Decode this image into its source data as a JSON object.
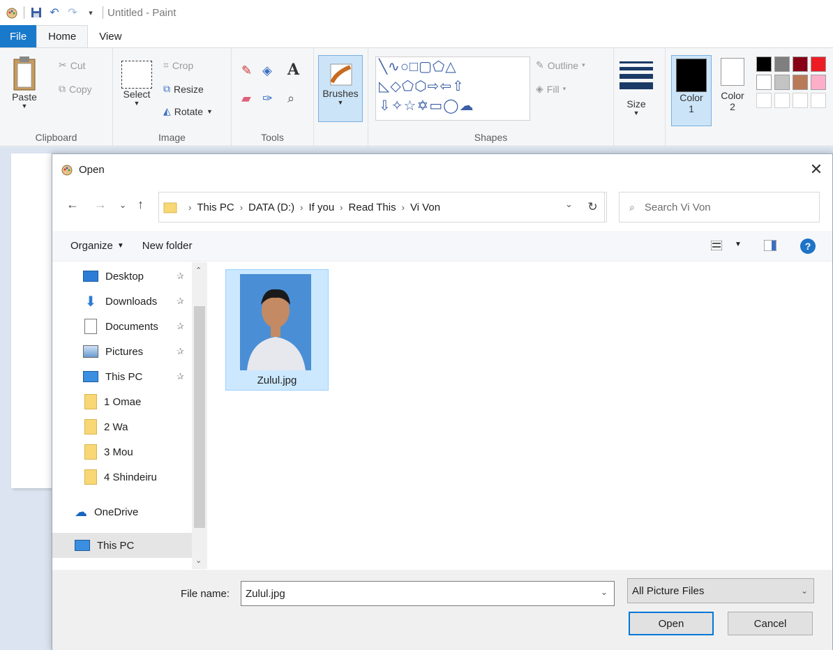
{
  "window": {
    "title": "Untitled - Paint"
  },
  "tabs": [
    {
      "label": "File"
    },
    {
      "label": "Home"
    },
    {
      "label": "View"
    }
  ],
  "ribbon": {
    "clipboard": {
      "label": "Clipboard",
      "paste": "Paste",
      "cut": "Cut",
      "copy": "Copy"
    },
    "image": {
      "label": "Image",
      "select": "Select",
      "crop": "Crop",
      "resize": "Resize",
      "rotate": "Rotate"
    },
    "tools": {
      "label": "Tools"
    },
    "brushes": {
      "label": "Brushes"
    },
    "shapes": {
      "label": "Shapes",
      "outline": "Outline",
      "fill": "Fill"
    },
    "size": {
      "label": "Size"
    },
    "color1": {
      "label": "Color",
      "num": "1"
    },
    "color2": {
      "label": "Color",
      "num": "2"
    },
    "palette": [
      "#000000",
      "#7f7f7f",
      "#880015",
      "#ed1c24",
      "#ffffff",
      "#c3c3c3",
      "#b97a57",
      "#ffaec9"
    ]
  },
  "dialog": {
    "title": "Open",
    "breadcrumb": [
      "This PC",
      "DATA (D:)",
      "If you",
      "Read This",
      "Vi Von"
    ],
    "search_placeholder": "Search Vi Von",
    "organize": "Organize",
    "new_folder": "New folder",
    "nav_items": [
      {
        "label": "Desktop",
        "pinned": true
      },
      {
        "label": "Downloads",
        "pinned": true
      },
      {
        "label": "Documents",
        "pinned": true
      },
      {
        "label": "Pictures",
        "pinned": true
      },
      {
        "label": "This PC",
        "pinned": true
      },
      {
        "label": "1 Omae",
        "pinned": false
      },
      {
        "label": "2 Wa",
        "pinned": false
      },
      {
        "label": "3 Mou",
        "pinned": false
      },
      {
        "label": "4 Shindeiru",
        "pinned": false
      },
      {
        "label": "OneDrive",
        "pinned": false
      },
      {
        "label": "This PC",
        "pinned": false
      }
    ],
    "files": [
      {
        "name": "Zulul.jpg",
        "selected": true
      }
    ],
    "filename_label": "File name:",
    "filename_value": "Zulul.jpg",
    "filter": "All Picture Files",
    "open_button": "Open",
    "cancel_button": "Cancel"
  }
}
